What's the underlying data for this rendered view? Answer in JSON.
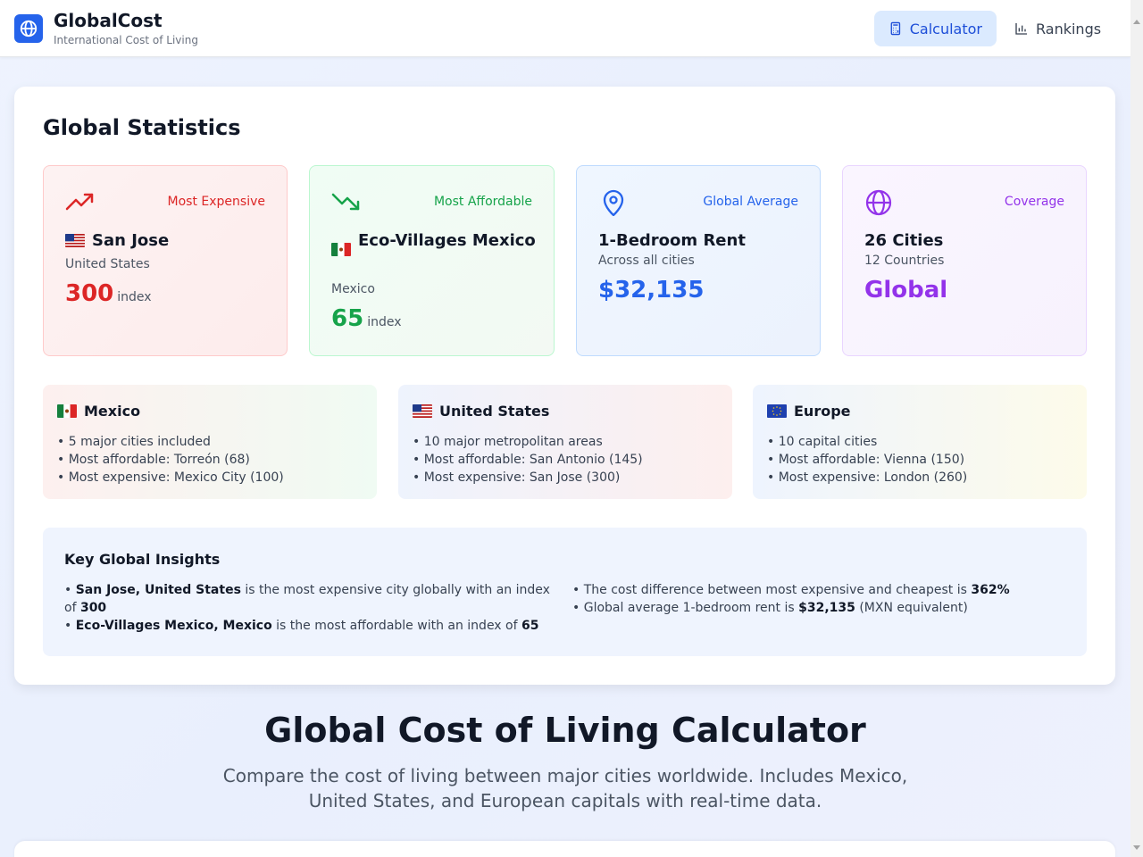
{
  "header": {
    "brand": "GlobalCost",
    "subtitle": "International Cost of Living",
    "nav": {
      "calculator": "Calculator",
      "rankings": "Rankings"
    }
  },
  "stats": {
    "title": "Global Statistics",
    "expensive": {
      "tag": "Most Expensive",
      "name": "San Jose",
      "country": "United States",
      "value": "300",
      "unit": "index"
    },
    "affordable": {
      "tag": "Most Affordable",
      "name": "Eco-Villages Mexico",
      "country": "Mexico",
      "value": "65",
      "unit": "index"
    },
    "average": {
      "tag": "Global Average",
      "name": "1-Bedroom Rent",
      "sub": "Across all cities",
      "value": "$32,135"
    },
    "coverage": {
      "tag": "Coverage",
      "name": "26 Cities",
      "sub": "12 Countries",
      "value": "Global"
    }
  },
  "regions": [
    {
      "name": "Mexico",
      "items": [
        "• 5 major cities included",
        "• Most affordable: Torreón (68)",
        "• Most expensive: Mexico City (100)"
      ]
    },
    {
      "name": "United States",
      "items": [
        "• 10 major metropolitan areas",
        "• Most affordable: San Antonio (145)",
        "• Most expensive: San Jose (300)"
      ]
    },
    {
      "name": "Europe",
      "items": [
        "• 10 capital cities",
        "• Most affordable: Vienna (150)",
        "• Most expensive: London (260)"
      ]
    }
  ],
  "insights": {
    "title": "Key Global Insights",
    "l1_bold": "San Jose, United States",
    "l1_text": " is the most expensive city globally with an index of ",
    "l1_value": "300",
    "l2_bold": "Eco-Villages Mexico, Mexico",
    "l2_text": " is the most affordable with an index of ",
    "l2_value": "65",
    "r1_text": "The cost difference between most expensive and cheapest is ",
    "r1_value": "362%",
    "r2_text": "Global average 1-bedroom rent is ",
    "r2_value": "$32,135",
    "r2_suffix": " (MXN equivalent)"
  },
  "hero": {
    "title": "Global Cost of Living Calculator",
    "subtitle": "Compare the cost of living between major cities worldwide. Includes Mexico, United States, and European capitals with real-time data."
  },
  "colors": {
    "primary": "#2563eb",
    "red": "#dc2626",
    "green": "#16a34a",
    "blue": "#2563eb",
    "purple": "#9333ea"
  }
}
